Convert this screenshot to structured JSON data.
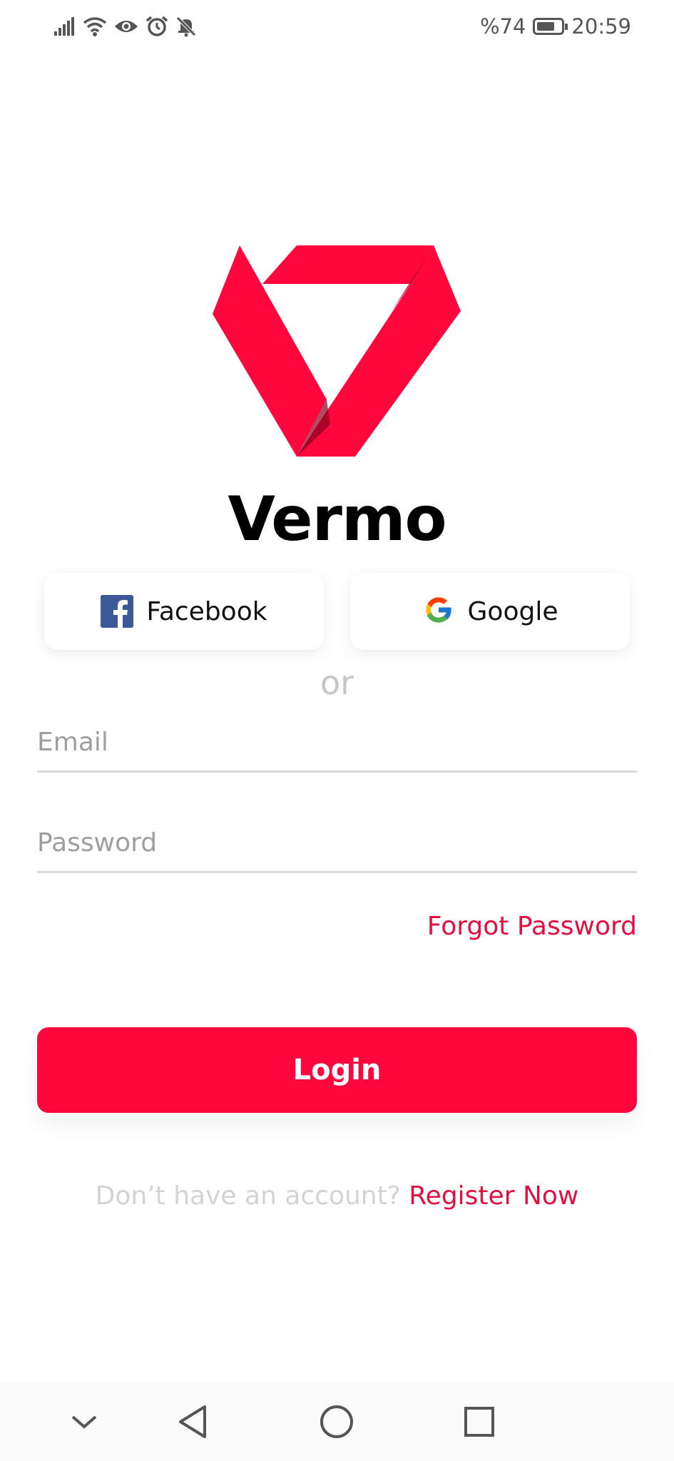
{
  "status_bar": {
    "battery_text": "%74",
    "battery_level": 0.74,
    "time": "20:59",
    "icons": [
      "signal-icon",
      "wifi-icon",
      "eye-icon",
      "alarm-icon",
      "notifications-off-icon"
    ]
  },
  "app": {
    "name": "Vermo",
    "brand_color": "#ff063d"
  },
  "social": {
    "facebook_label": "Facebook",
    "google_label": "Google"
  },
  "divider_text": "or",
  "form": {
    "email_placeholder": "Email",
    "email_value": "",
    "password_placeholder": "Password",
    "password_value": "",
    "forgot_label": "Forgot Password",
    "login_label": "Login"
  },
  "register": {
    "prompt": "Don’t have an account?",
    "link": "Register Now"
  },
  "nav_bar": {
    "icons": [
      "chevron-down-icon",
      "back-icon",
      "home-icon",
      "recents-icon"
    ]
  }
}
